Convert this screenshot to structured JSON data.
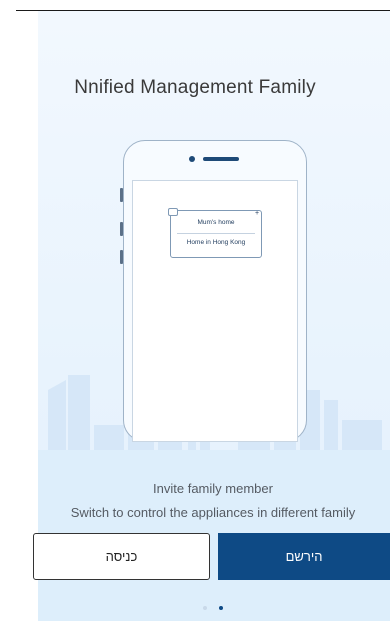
{
  "onboarding": {
    "title": "Nnified Management Family",
    "popup": {
      "items": [
        "Mum's home",
        "Home in Hong Kong"
      ]
    },
    "subtitle_line1": "Invite family member",
    "subtitle_line2": "Switch to control the appliances in different family"
  },
  "buttons": {
    "login_label": "כניסה",
    "register_label": "הירשם"
  },
  "pager": {
    "total": 2,
    "active_index": 1
  },
  "colors": {
    "primary": "#0e4a85",
    "background": "#e8f3fd",
    "text": "#555b63"
  }
}
